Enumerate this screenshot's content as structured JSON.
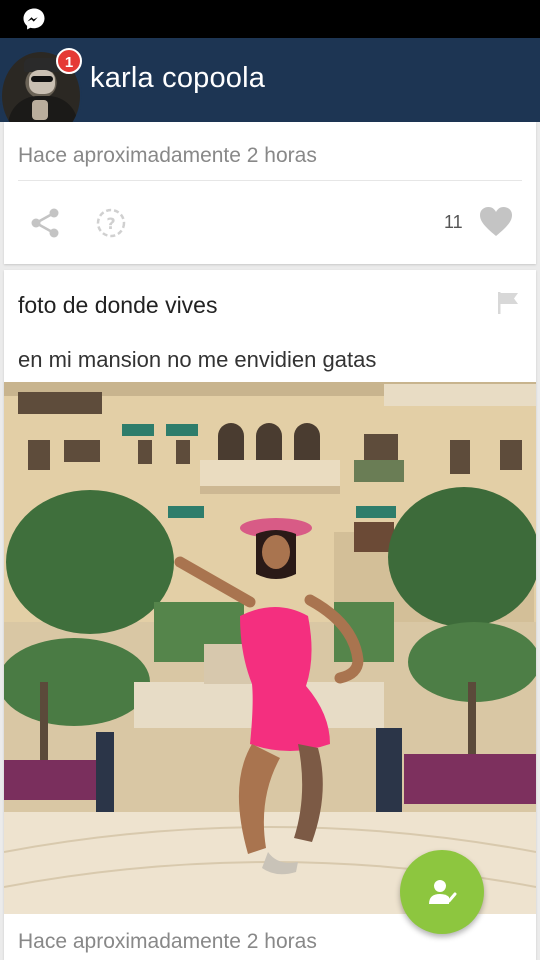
{
  "status_bar": {
    "app_icon": "messenger-icon"
  },
  "header": {
    "user_name": "karla copoola",
    "notification_count": "1"
  },
  "top_card": {
    "timestamp": "Hace aproximadamente 2 horas",
    "actions": {
      "share_icon": "share-icon",
      "help_icon": "help-icon"
    },
    "like_count": "11",
    "like_icon": "heart-icon"
  },
  "post": {
    "title": "foto de donde vives",
    "body": "en mi mansion no me envidien gatas",
    "flag_icon": "flag-icon",
    "photo_subject": "mansion-courtyard-with-woman-in-pink-dress",
    "timestamp": "Hace aproximadamente 2 horas"
  },
  "fab": {
    "icon": "add-user-icon",
    "color": "#8dc63f"
  },
  "colors": {
    "header_bg": "#1d3553",
    "badge": "#e53935",
    "fab": "#8dc63f"
  }
}
